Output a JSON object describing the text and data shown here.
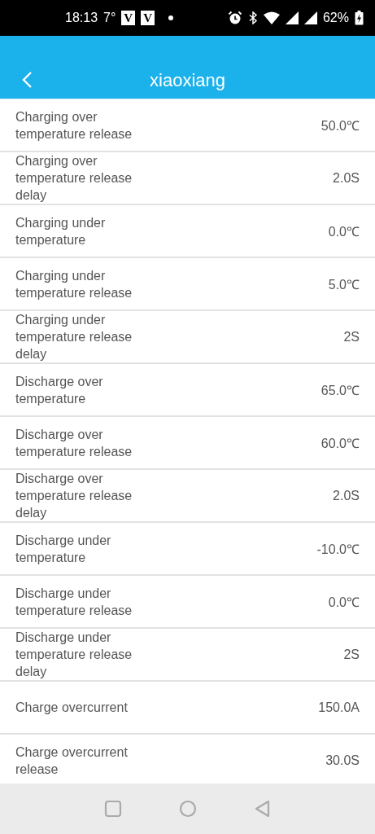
{
  "status_bar": {
    "time": "18:13",
    "temperature": "7°",
    "notification_badges": [
      "V",
      "V"
    ],
    "battery": "62%"
  },
  "header": {
    "title": "xiaoxiang"
  },
  "settings": [
    {
      "label": "Charging over temperature release",
      "value": "50.0℃"
    },
    {
      "label": "Charging over temperature release delay",
      "value": "2.0S"
    },
    {
      "label": "Charging under temperature",
      "value": "0.0℃"
    },
    {
      "label": "Charging under temperature release",
      "value": "5.0℃"
    },
    {
      "label": "Charging under temperature release delay",
      "value": "2S"
    },
    {
      "label": "Discharge over temperature",
      "value": "65.0℃"
    },
    {
      "label": "Discharge over temperature release",
      "value": "60.0℃"
    },
    {
      "label": "Discharge over temperature release delay",
      "value": "2.0S"
    },
    {
      "label": "Discharge under temperature",
      "value": "-10.0℃"
    },
    {
      "label": "Discharge under temperature release",
      "value": "0.0℃"
    },
    {
      "label": "Discharge under temperature release delay",
      "value": "2S"
    },
    {
      "label": "Charge overcurrent",
      "value": "150.0A"
    },
    {
      "label": "Charge overcurrent release",
      "value": "30.0S"
    }
  ]
}
